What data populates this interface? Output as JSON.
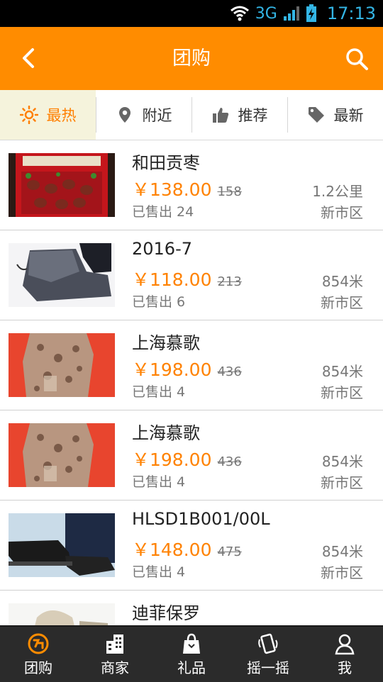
{
  "status_bar": {
    "network": "3G",
    "time": "17:13"
  },
  "header": {
    "title": "团购"
  },
  "tabs": [
    {
      "label": "最热",
      "icon": "sun-icon",
      "active": true
    },
    {
      "label": "附近",
      "icon": "location-pin-icon",
      "active": false
    },
    {
      "label": "推荐",
      "icon": "thumbs-up-icon",
      "active": false
    },
    {
      "label": "最新",
      "icon": "tag-icon",
      "active": false
    }
  ],
  "colors": {
    "accent": "#ff8c00",
    "price": "#ff8200",
    "nav_bg": "#2b2b2b"
  },
  "deals": [
    {
      "name": "和田贡枣",
      "price": "￥138.00",
      "original_price": "158",
      "sold": "已售出 24",
      "distance": "1.2公里",
      "area": "新市区"
    },
    {
      "name": "2016-7",
      "price": "￥118.00",
      "original_price": "213",
      "sold": "已售出 6",
      "distance": "854米",
      "area": "新市区"
    },
    {
      "name": "上海慕歌",
      "price": "￥198.00",
      "original_price": "436",
      "sold": "已售出 4",
      "distance": "854米",
      "area": "新市区"
    },
    {
      "name": "上海慕歌",
      "price": "￥198.00",
      "original_price": "436",
      "sold": "已售出 4",
      "distance": "854米",
      "area": "新市区"
    },
    {
      "name": "HLSD1B001/00L",
      "price": "￥148.00",
      "original_price": "475",
      "sold": "已售出 4",
      "distance": "854米",
      "area": "新市区"
    },
    {
      "name": "迪菲保罗"
    }
  ],
  "bottom_nav": [
    {
      "label": "团购",
      "icon": "tuangou-icon",
      "active": true
    },
    {
      "label": "商家",
      "icon": "building-icon",
      "active": false
    },
    {
      "label": "礼品",
      "icon": "gift-bag-icon",
      "active": false
    },
    {
      "label": "摇一摇",
      "icon": "shake-phone-icon",
      "active": false
    },
    {
      "label": "我",
      "icon": "user-icon",
      "active": false
    }
  ]
}
